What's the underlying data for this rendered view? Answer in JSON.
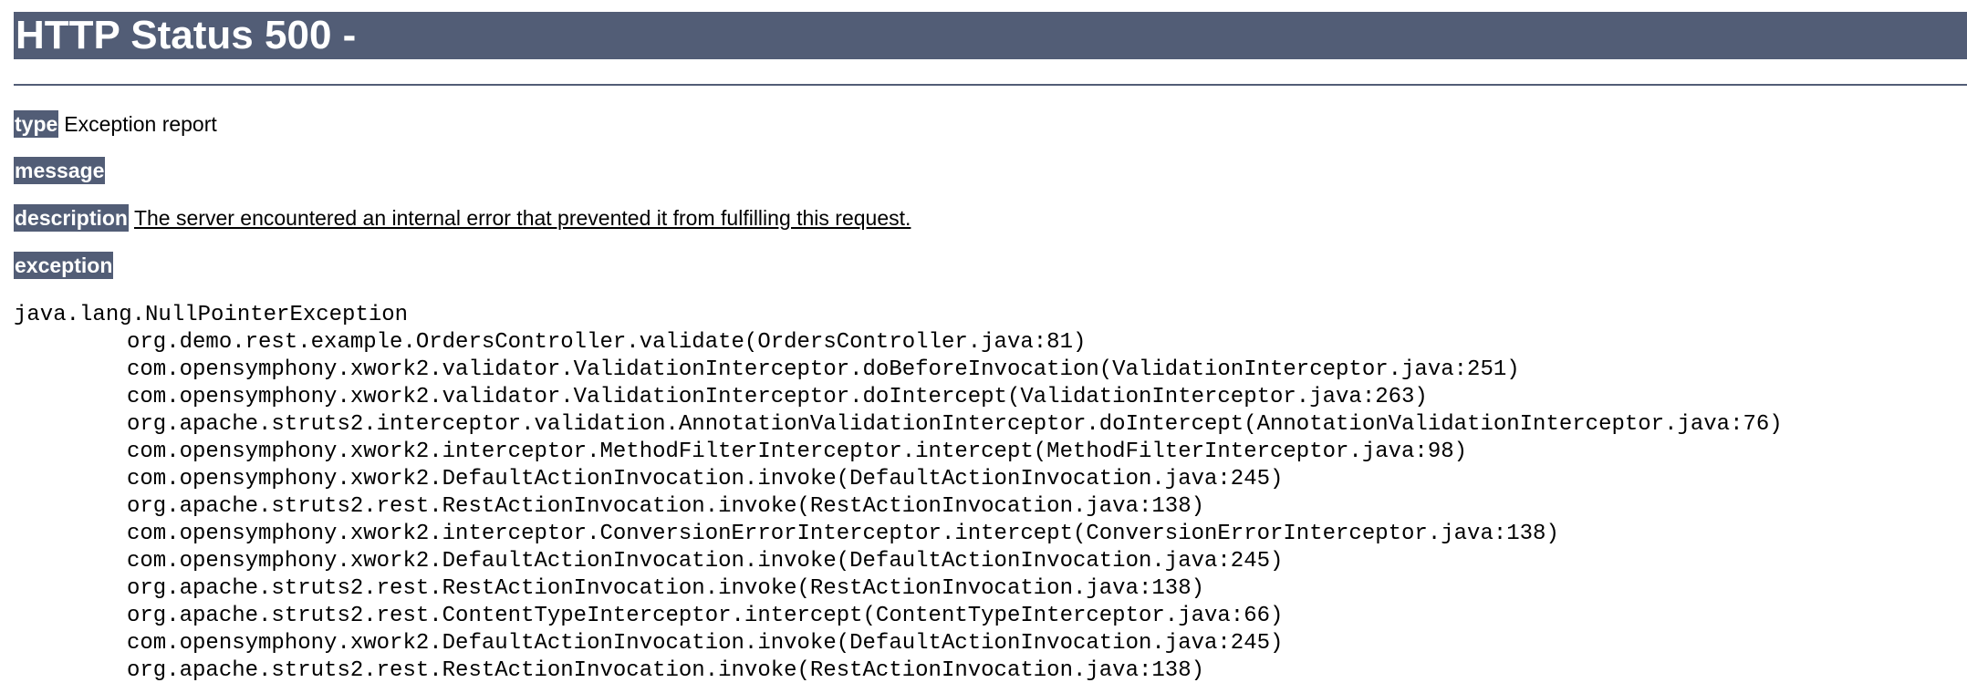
{
  "header": {
    "title": "HTTP Status 500 -"
  },
  "fields": {
    "type_label": "type",
    "type_value": "Exception report",
    "message_label": "message",
    "message_value": "",
    "description_label": "description",
    "description_value": "The server encountered an internal error that prevented it from fulfilling this request.",
    "exception_label": "exception"
  },
  "stack_trace": {
    "exception": "java.lang.NullPointerException",
    "frames": [
      "org.demo.rest.example.OrdersController.validate(OrdersController.java:81)",
      "com.opensymphony.xwork2.validator.ValidationInterceptor.doBeforeInvocation(ValidationInterceptor.java:251)",
      "com.opensymphony.xwork2.validator.ValidationInterceptor.doIntercept(ValidationInterceptor.java:263)",
      "org.apache.struts2.interceptor.validation.AnnotationValidationInterceptor.doIntercept(AnnotationValidationInterceptor.java:76)",
      "com.opensymphony.xwork2.interceptor.MethodFilterInterceptor.intercept(MethodFilterInterceptor.java:98)",
      "com.opensymphony.xwork2.DefaultActionInvocation.invoke(DefaultActionInvocation.java:245)",
      "org.apache.struts2.rest.RestActionInvocation.invoke(RestActionInvocation.java:138)",
      "com.opensymphony.xwork2.interceptor.ConversionErrorInterceptor.intercept(ConversionErrorInterceptor.java:138)",
      "com.opensymphony.xwork2.DefaultActionInvocation.invoke(DefaultActionInvocation.java:245)",
      "org.apache.struts2.rest.RestActionInvocation.invoke(RestActionInvocation.java:138)",
      "org.apache.struts2.rest.ContentTypeInterceptor.intercept(ContentTypeInterceptor.java:66)",
      "com.opensymphony.xwork2.DefaultActionInvocation.invoke(DefaultActionInvocation.java:245)",
      "org.apache.struts2.rest.RestActionInvocation.invoke(RestActionInvocation.java:138)"
    ]
  },
  "colors": {
    "header_bg": "#525D76",
    "header_text": "#ffffff",
    "page_bg": "#ffffff",
    "text": "#000000"
  }
}
